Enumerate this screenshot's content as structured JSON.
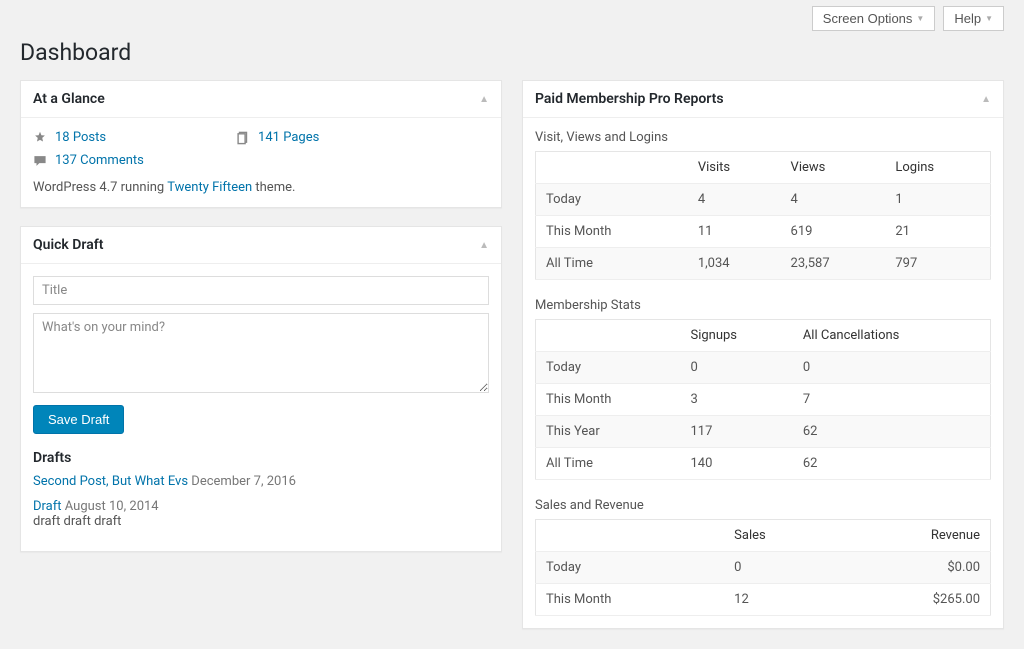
{
  "topbar": {
    "screen_options": "Screen Options",
    "help": "Help"
  },
  "page_title": "Dashboard",
  "glance": {
    "title": "At a Glance",
    "posts": "18 Posts",
    "pages": "141 Pages",
    "comments": "137 Comments",
    "version_prefix": "WordPress 4.7 running ",
    "theme": "Twenty Fifteen",
    "version_suffix": " theme."
  },
  "quickdraft": {
    "title": "Quick Draft",
    "title_placeholder": "Title",
    "content_placeholder": "What's on your mind?",
    "save_label": "Save Draft",
    "drafts_heading": "Drafts",
    "drafts": [
      {
        "title": "Second Post, But What Evs",
        "date": "December 7, 2016",
        "excerpt": ""
      },
      {
        "title": "Draft",
        "date": "August 10, 2014",
        "excerpt": "draft draft draft"
      }
    ]
  },
  "reports": {
    "title": "Paid Membership Pro Reports",
    "visits": {
      "heading": "Visit, Views and Logins",
      "cols": [
        "",
        "Visits",
        "Views",
        "Logins"
      ],
      "rows": [
        [
          "Today",
          "4",
          "4",
          "1"
        ],
        [
          "This Month",
          "11",
          "619",
          "21"
        ],
        [
          "All Time",
          "1,034",
          "23,587",
          "797"
        ]
      ]
    },
    "membership": {
      "heading": "Membership Stats",
      "cols": [
        "",
        "Signups",
        "All Cancellations"
      ],
      "rows": [
        [
          "Today",
          "0",
          "0"
        ],
        [
          "This Month",
          "3",
          "7"
        ],
        [
          "This Year",
          "117",
          "62"
        ],
        [
          "All Time",
          "140",
          "62"
        ]
      ]
    },
    "sales": {
      "heading": "Sales and Revenue",
      "cols": [
        "",
        "Sales",
        "Revenue"
      ],
      "rows": [
        [
          "Today",
          "0",
          "$0.00"
        ],
        [
          "This Month",
          "12",
          "$265.00"
        ]
      ]
    }
  }
}
